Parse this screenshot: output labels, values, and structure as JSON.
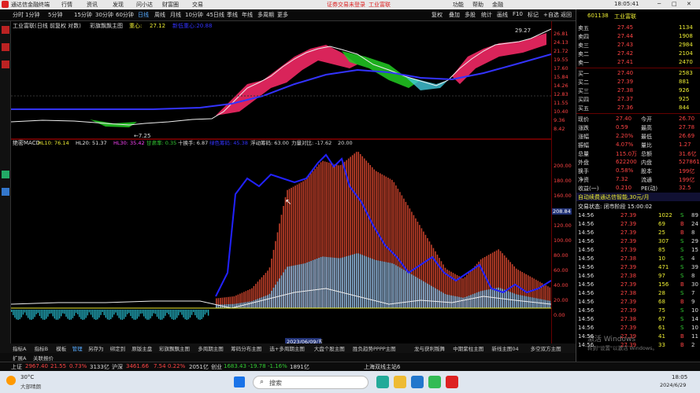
{
  "window": {
    "app_name": "通达信金融终端",
    "menus": [
      "行情",
      "资讯",
      "发现",
      "问小达",
      "财富圈",
      "交易"
    ],
    "notice": "证券交易未登录",
    "badge": "工业富联",
    "right_buttons": [
      "功能",
      "帮助",
      "金融"
    ]
  },
  "periods": {
    "items": [
      "分时",
      "1分钟",
      "5分钟",
      "15分钟",
      "30分钟",
      "60分钟",
      "日线",
      "周线",
      "月线",
      "10分钟",
      "45日线",
      "季线",
      "年线",
      "多周期",
      "更多"
    ],
    "selected": "日线",
    "right_items": [
      "复权",
      "叠加",
      "多股",
      "统计",
      "画线",
      "F10",
      "标记",
      "+自选",
      "返回"
    ]
  },
  "main_chart": {
    "title": "工业富联(日线 前复权 对数)",
    "indicator": "彩旗飘飘主图",
    "value_label": "重心:",
    "value": "27.12",
    "dotted_label": "新低重心:20.88",
    "high_label": "29.27",
    "low_label": "←7.25"
  },
  "sub_chart": {
    "title": "绝密MACD",
    "hl10": "HL10: 76.14",
    "hl20": "HL20: 51.37",
    "hl30": "HL30: 35.42",
    "ratio": "甘肃率: 0.35",
    "turnover": "十换手: 6.87",
    "signal": "绿色筹码: 45.38",
    "float": "浮动筹码: 63.00",
    "force": "力量对比: -17.62",
    "twenty": "20.00",
    "axis_marker": "208.84",
    "date_marker": "2023/06/09/五"
  },
  "axis_labels_top": [
    "26.81",
    "24.13",
    "21.72",
    "19.55",
    "17.60",
    "15.84",
    "14.26",
    "12.83",
    "11.55",
    "10.40",
    "9.36",
    "8.42"
  ],
  "axis_labels_bottom": [
    "200.00",
    "180.00",
    "160.00",
    "140.00",
    "120.00",
    "100.00",
    "80.00",
    "60.00",
    "40.00",
    "20.00",
    "0.00"
  ],
  "stock": {
    "code": "601138",
    "name": "工业富联"
  },
  "order_book": {
    "asks": [
      [
        "卖五",
        "27.45",
        "1134"
      ],
      [
        "卖四",
        "27.44",
        "1908"
      ],
      [
        "卖三",
        "27.43",
        "2984"
      ],
      [
        "卖二",
        "27.42",
        "2104"
      ],
      [
        "卖一",
        "27.41",
        "2470"
      ]
    ],
    "bids": [
      [
        "买一",
        "27.40",
        "2583"
      ],
      [
        "买二",
        "27.39",
        "881"
      ],
      [
        "买三",
        "27.38",
        "926"
      ],
      [
        "买四",
        "27.37",
        "925"
      ],
      [
        "买五",
        "27.36",
        "844"
      ]
    ]
  },
  "quote": [
    [
      "现价",
      "27.40",
      "今开",
      "26.70"
    ],
    [
      "涨跌",
      "0.59",
      "最高",
      "27.78"
    ],
    [
      "涨幅",
      "2.20%",
      "最低",
      "26.69"
    ],
    [
      "振幅",
      "4.07%",
      "量比",
      "1.27"
    ],
    [
      "总量",
      "115.0万",
      "总额",
      "31.6亿"
    ],
    [
      "外盘",
      "622200",
      "内盘",
      "527861"
    ],
    [
      "换手",
      "0.58%",
      "股本",
      "199亿"
    ],
    [
      "净资",
      "7.32",
      "流通",
      "199亿"
    ],
    [
      "收益(一)",
      "0.210",
      "PE(动)",
      "32.5"
    ]
  ],
  "service": {
    "ad": "自动续费通达信智能,30元/月",
    "trade_status": "交易状态: 闭市阶段 15:00:02"
  },
  "ticks": [
    [
      "14:56",
      "27.39",
      "1022",
      "S",
      "89"
    ],
    [
      "14:56",
      "27.39",
      "69",
      "B",
      "24"
    ],
    [
      "14:56",
      "27.39",
      "25",
      "B",
      "8"
    ],
    [
      "14:56",
      "27.39",
      "307",
      "S",
      "29"
    ],
    [
      "14:56",
      "27.39",
      "85",
      "S",
      "15"
    ],
    [
      "14:56",
      "27.38",
      "10",
      "S",
      "4"
    ],
    [
      "14:56",
      "27.39",
      "471",
      "S",
      "39"
    ],
    [
      "14:56",
      "27.38",
      "97",
      "S",
      "8"
    ],
    [
      "14:56",
      "27.39",
      "156",
      "B",
      "30"
    ],
    [
      "14:56",
      "27.38",
      "28",
      "S",
      "7"
    ],
    [
      "14:56",
      "27.39",
      "68",
      "B",
      "9"
    ],
    [
      "14:56",
      "27.39",
      "75",
      "S",
      "10"
    ],
    [
      "14:56",
      "27.38",
      "67",
      "S",
      "14"
    ],
    [
      "14:56",
      "27.39",
      "61",
      "S",
      "10"
    ],
    [
      "14:56",
      "27.39",
      "41",
      "B",
      "11"
    ],
    [
      "14:56",
      "27.39",
      "33",
      "B",
      "2"
    ]
  ],
  "bottom_tabs": [
    "指标A",
    "指标B",
    "模板",
    "管理",
    "另存为",
    "绑定到",
    "原版主盘",
    "彩旗飘飘主图",
    "多周期主图",
    "筹码分布主图",
    "选+多周期主图",
    "大盘个股主图",
    "胜负趋势PPPP主图",
    "龙与获利叛舞",
    "中期紫柱主图",
    "新线主图04",
    "多空双方主图"
  ],
  "status_bar": [
    {
      "label": "上证",
      "value": "2967.40",
      "change": "21.55",
      "pct": "0.73%",
      "vol": "3133亿"
    },
    {
      "label": "沪深",
      "value": "3461.66",
      "change": "7.54",
      "pct": "0.22%",
      "vol": "2051亿"
    },
    {
      "label": "创业",
      "value": "1683.43",
      "change": "-19.78",
      "pct": "-1.16%",
      "vol": "1891亿"
    }
  ],
  "status_extra": [
    "上海双线主站6",
    "扩展A",
    "关联报价"
  ],
  "taskbar": {
    "weather": "30°C",
    "weather_desc": "大部晴朗",
    "search_placeholder": "搜索",
    "time": "18:05",
    "date": "2024/6/29"
  },
  "watermark": {
    "line1": "激活 Windows",
    "line2": "转到\"设置\"以激活 Windows。"
  },
  "chart_data": [
    {
      "type": "area",
      "title": "工业富联(日线 前复权 对数)",
      "series": [
        {
          "name": "重心",
          "values": [
            8,
            8,
            7.5,
            7.25,
            8,
            9,
            10,
            12,
            14,
            17,
            19,
            20,
            22,
            21,
            20,
            19,
            18,
            19,
            21,
            22,
            23,
            24,
            26,
            27,
            28,
            29
          ]
        }
      ]
    },
    {
      "type": "bar",
      "title": "绝密MACD",
      "series": [
        {
          "name": "HL10",
          "values": [
            10,
            12,
            20,
            40,
            120,
            130,
            150,
            145,
            160,
            140,
            130,
            100,
            70,
            40,
            30,
            50,
            60,
            40,
            30,
            20
          ]
        }
      ]
    }
  ]
}
